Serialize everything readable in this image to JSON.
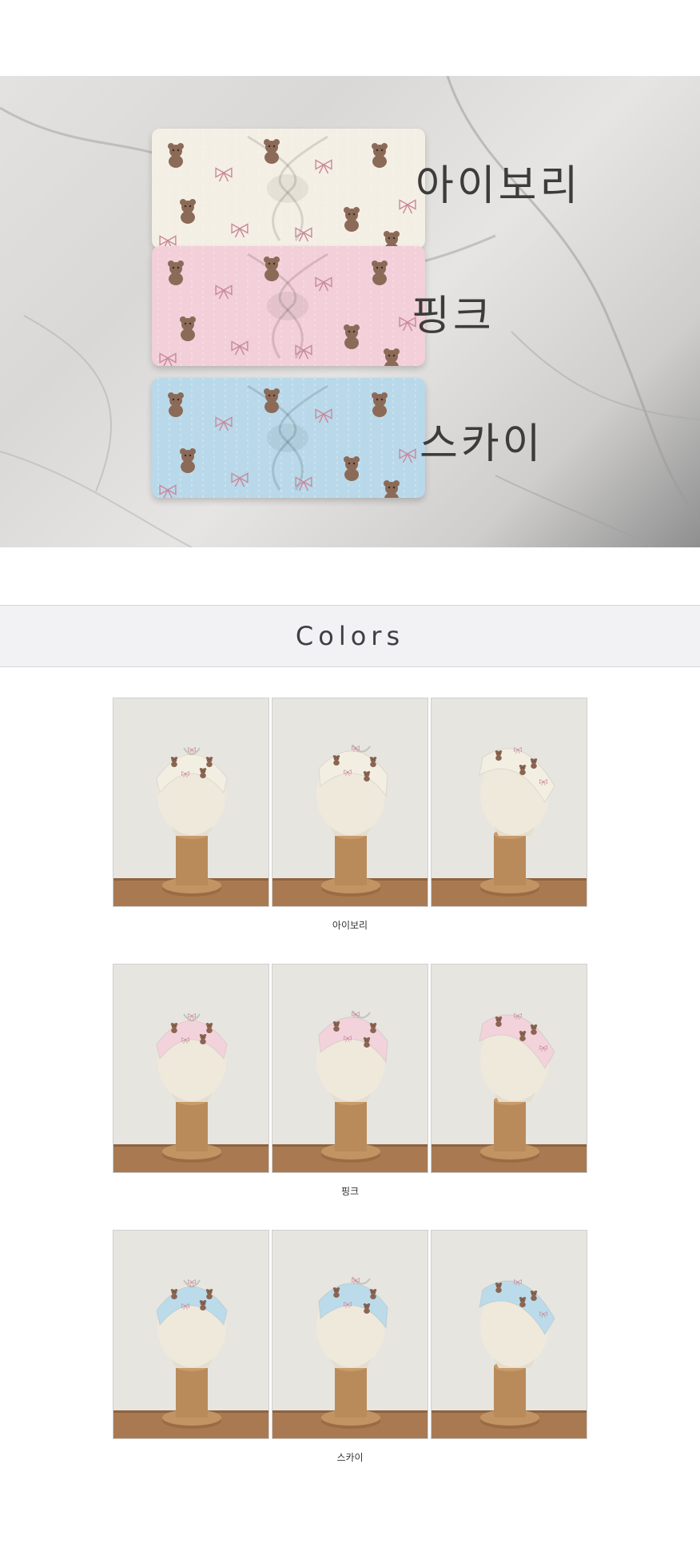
{
  "hero": {
    "labels": [
      "아이보리",
      "핑크",
      "스카이"
    ]
  },
  "colors_section": {
    "title": "Colors"
  },
  "variants": [
    {
      "caption": "아이보리",
      "band_color": "#f3eee2",
      "print_color": "#8a6552"
    },
    {
      "caption": "핑크",
      "band_color": "#f2d3dc",
      "print_color": "#8a6552"
    },
    {
      "caption": "스카이",
      "band_color": "#bcdbea",
      "print_color": "#8a6552"
    }
  ],
  "colors": {
    "ivory": "#f4efe4",
    "pink": "#f2cfd9",
    "sky": "#b9d9ea",
    "bear": "#8c6a58",
    "bow": "#c98a9c",
    "header_bg": "#f2f2f4",
    "stand_wood": "#b98b5a",
    "shelf_wood": "#a97a52"
  },
  "icons": [
    "bear-print-icon",
    "bow-print-icon"
  ]
}
